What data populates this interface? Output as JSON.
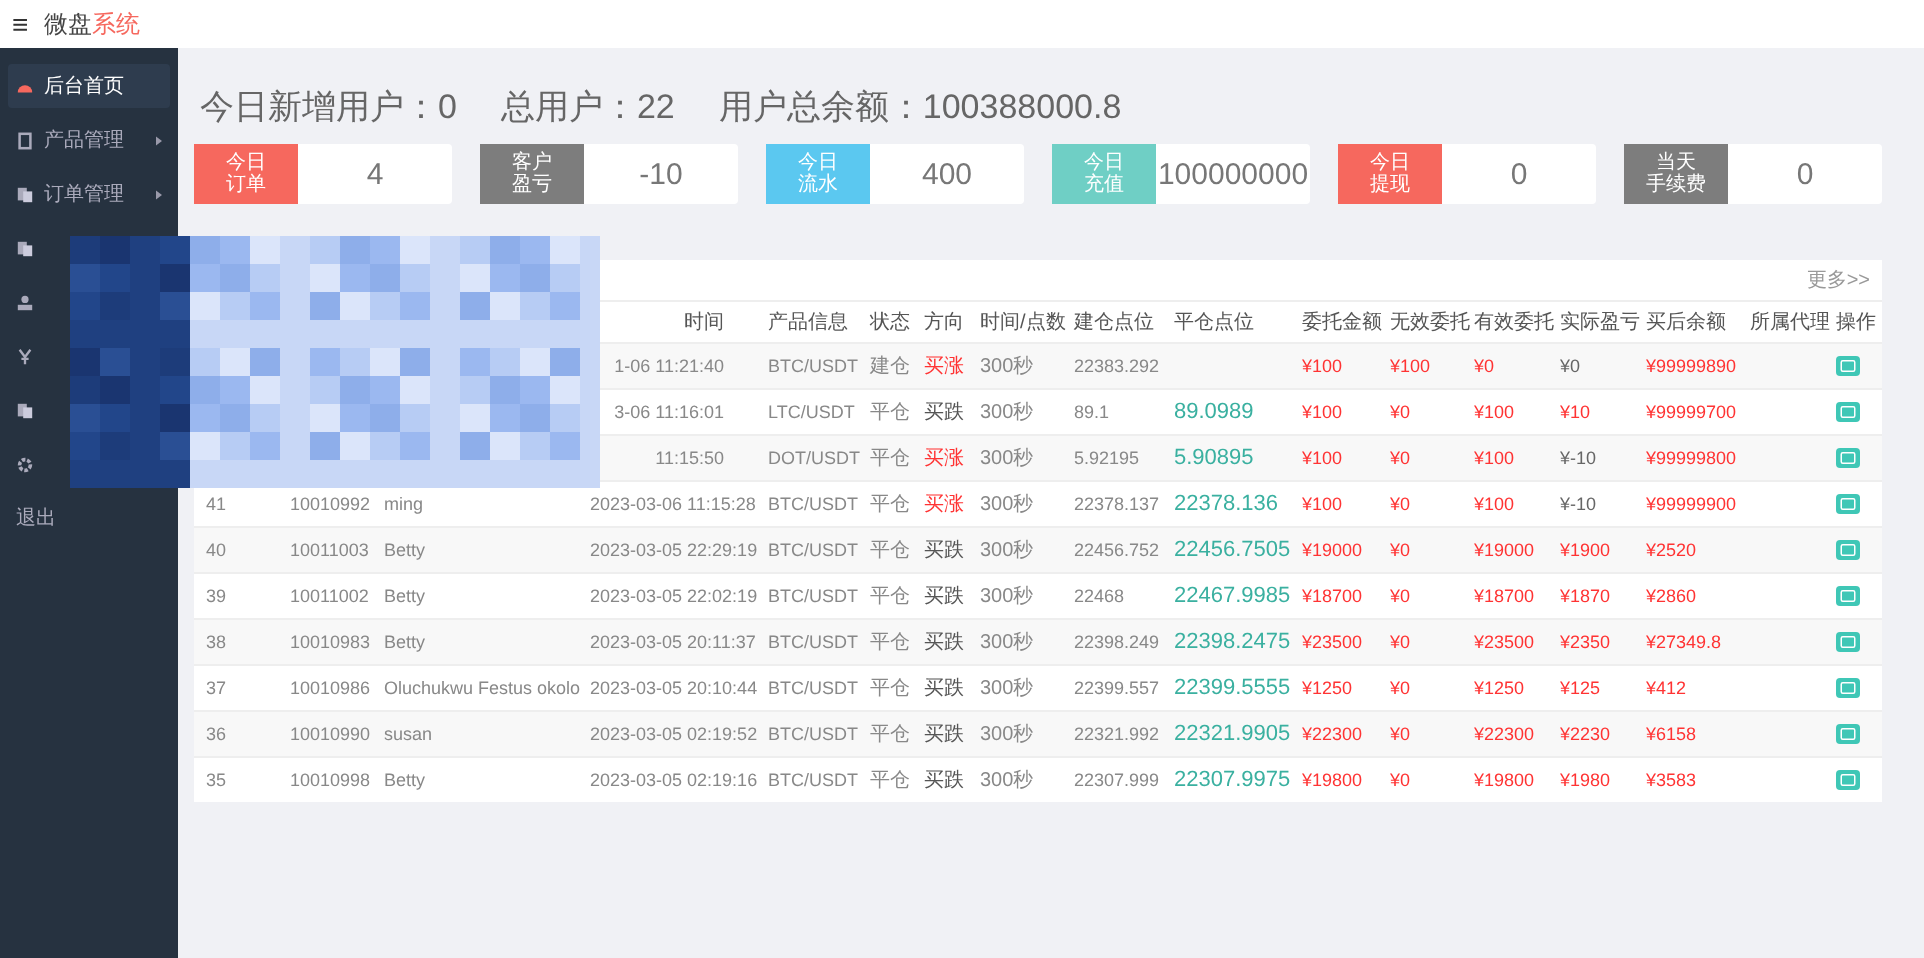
{
  "header": {
    "menu_glyph": "≡",
    "brand": "微盘",
    "brand_accent": "系统"
  },
  "sidebar": {
    "items": [
      {
        "kind": "gauge",
        "label": "后台首页",
        "selected": true,
        "arrow": false
      },
      {
        "kind": "box",
        "label": "产品管理",
        "selected": false,
        "arrow": true
      },
      {
        "kind": "doc",
        "label": "订单管理",
        "selected": false,
        "arrow": true
      },
      {
        "kind": "doc",
        "selected": false
      },
      {
        "kind": "user",
        "selected": false
      },
      {
        "kind": "yen",
        "selected": false
      },
      {
        "kind": "doc",
        "selected": false
      },
      {
        "kind": "gear",
        "selected": false
      },
      {
        "kind": "text",
        "label": "退出",
        "selected": false,
        "arrow": false
      }
    ]
  },
  "summary": [
    "今日新增用户：0",
    "总用户：22",
    "用户总余额：100388000.8"
  ],
  "cards": [
    {
      "label_lines": [
        "今日",
        "订单"
      ],
      "value": "4",
      "color": "#f6685e"
    },
    {
      "label_lines": [
        "客户",
        "盈亏"
      ],
      "value": "-10",
      "color": "#7d7d7d"
    },
    {
      "label_lines": [
        "今日",
        "流水"
      ],
      "value": "400",
      "color": "#5bc8f0"
    },
    {
      "label_lines": [
        "今日",
        "充值"
      ],
      "value": "100000000",
      "color": "#6fcfc5"
    },
    {
      "label_lines": [
        "今日",
        "提现"
      ],
      "value": "0",
      "color": "#f6685e"
    },
    {
      "label_lines": [
        "当天",
        "手续费"
      ],
      "value": "0",
      "color": "#7d7d7d"
    }
  ],
  "table": {
    "more": "更多>>",
    "columns": [
      {},
      {},
      {},
      {
        "label": "时间",
        "partial": true
      },
      {
        "label": "产品信息"
      },
      {
        "label": "状态"
      },
      {
        "label": "方向"
      },
      {
        "label": "时间/点数"
      },
      {
        "label": "建仓点位"
      },
      {
        "label": "平仓点位"
      },
      {
        "label": "委托金额"
      },
      {
        "label": "无效委托"
      },
      {
        "label": "有效委托"
      },
      {
        "label": "实际盈亏"
      },
      {
        "label": "买后余额"
      },
      {
        "label": "所属代理"
      },
      {
        "label": "操作"
      }
    ],
    "rows": [
      {
        "time": "1-06 11:21:40",
        "time_partial": true,
        "product": "BTC/USDT",
        "status": "建仓",
        "direction": "买涨",
        "kind": "up",
        "period": "300秒",
        "open": "22383.292",
        "entrust": "¥100",
        "invalid": "¥100",
        "valid": "¥0",
        "actual": "¥0",
        "actual_loss": true,
        "balance": "¥99999890"
      },
      {
        "time": "3-06 11:16:01",
        "time_partial": true,
        "product": "LTC/USDT",
        "status": "平仓",
        "direction": "买跌",
        "kind": "down",
        "period": "300秒",
        "open": "89.1",
        "close": "89.0989",
        "entrust": "¥100",
        "invalid": "¥0",
        "valid": "¥100",
        "actual": "¥10",
        "actual_loss": false,
        "balance": "¥99999700"
      },
      {
        "time": "11:15:50",
        "time_partial": true,
        "product": "DOT/USDT",
        "status": "平仓",
        "direction": "买涨",
        "kind": "up",
        "period": "300秒",
        "open": "5.92195",
        "close": "5.90895",
        "entrust": "¥100",
        "invalid": "¥0",
        "valid": "¥100",
        "actual": "¥-10",
        "actual_loss": true,
        "balance": "¥99999800"
      },
      {
        "no": "41",
        "uid": "10010992",
        "name": "ming",
        "time": "2023-03-06 11:15:28",
        "product": "BTC/USDT",
        "status": "平仓",
        "direction": "买涨",
        "kind": "up",
        "period": "300秒",
        "open": "22378.137",
        "close": "22378.136",
        "entrust": "¥100",
        "invalid": "¥0",
        "valid": "¥100",
        "actual": "¥-10",
        "actual_loss": true,
        "balance": "¥99999900"
      },
      {
        "no": "40",
        "uid": "10011003",
        "name": "Betty",
        "time": "2023-03-05 22:29:19",
        "product": "BTC/USDT",
        "status": "平仓",
        "direction": "买跌",
        "kind": "down",
        "period": "300秒",
        "open": "22456.752",
        "close": "22456.7505",
        "entrust": "¥19000",
        "invalid": "¥0",
        "valid": "¥19000",
        "actual": "¥1900",
        "actual_loss": false,
        "balance": "¥2520"
      },
      {
        "no": "39",
        "uid": "10011002",
        "name": "Betty",
        "time": "2023-03-05 22:02:19",
        "product": "BTC/USDT",
        "status": "平仓",
        "direction": "买跌",
        "kind": "down",
        "period": "300秒",
        "open": "22468",
        "close": "22467.9985",
        "entrust": "¥18700",
        "invalid": "¥0",
        "valid": "¥18700",
        "actual": "¥1870",
        "actual_loss": false,
        "balance": "¥2860"
      },
      {
        "no": "38",
        "uid": "10010983",
        "name": "Betty",
        "time": "2023-03-05 20:11:37",
        "product": "BTC/USDT",
        "status": "平仓",
        "direction": "买跌",
        "kind": "down",
        "period": "300秒",
        "open": "22398.249",
        "close": "22398.2475",
        "entrust": "¥23500",
        "invalid": "¥0",
        "valid": "¥23500",
        "actual": "¥2350",
        "actual_loss": false,
        "balance": "¥27349.8"
      },
      {
        "no": "37",
        "uid": "10010986",
        "name": "Oluchukwu Festus okolo",
        "time": "2023-03-05 20:10:44",
        "product": "BTC/USDT",
        "status": "平仓",
        "direction": "买跌",
        "kind": "down",
        "period": "300秒",
        "open": "22399.557",
        "close": "22399.5555",
        "entrust": "¥1250",
        "invalid": "¥0",
        "valid": "¥1250",
        "actual": "¥125",
        "actual_loss": false,
        "balance": "¥412"
      },
      {
        "no": "36",
        "uid": "10010990",
        "name": "susan",
        "time": "2023-03-05 02:19:52",
        "product": "BTC/USDT",
        "status": "平仓",
        "direction": "买跌",
        "kind": "down",
        "period": "300秒",
        "open": "22321.992",
        "close": "22321.9905",
        "entrust": "¥22300",
        "invalid": "¥0",
        "valid": "¥22300",
        "actual": "¥2230",
        "actual_loss": false,
        "balance": "¥6158"
      },
      {
        "no": "35",
        "uid": "10010998",
        "name": "Betty",
        "time": "2023-03-05 02:19:16",
        "product": "BTC/USDT",
        "status": "平仓",
        "direction": "买跌",
        "kind": "down",
        "period": "300秒",
        "open": "22307.999",
        "close": "22307.9975",
        "entrust": "¥19800",
        "invalid": "¥0",
        "valid": "¥19800",
        "actual": "¥1980",
        "actual_loss": false,
        "balance": "¥3583"
      }
    ]
  }
}
